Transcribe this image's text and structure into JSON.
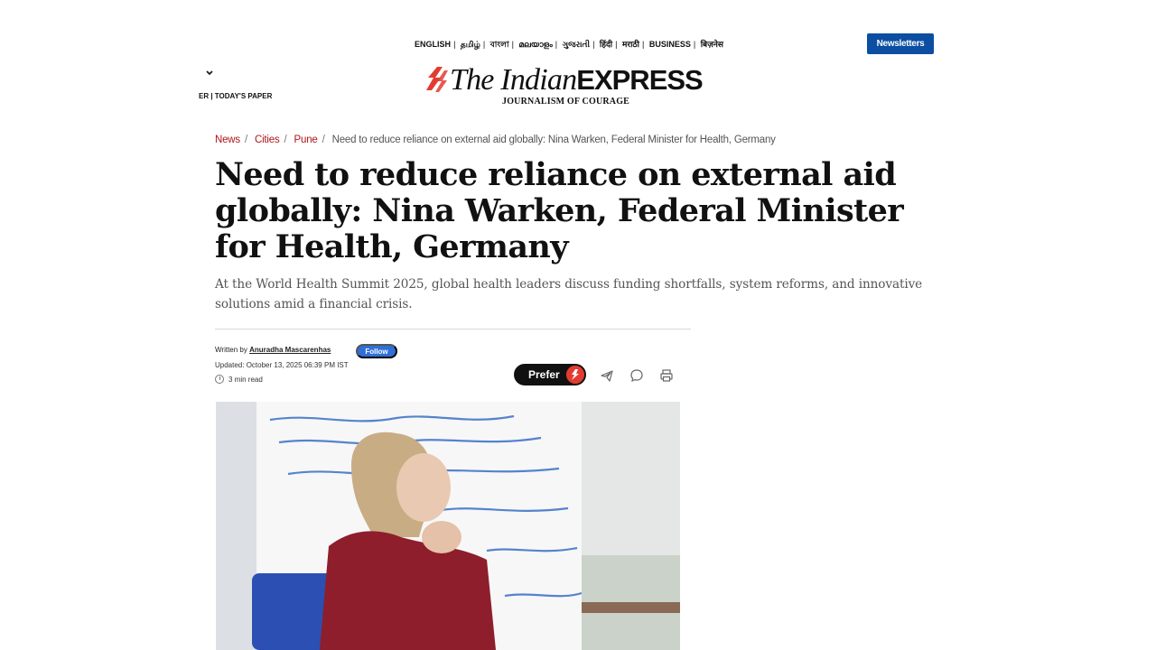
{
  "header": {
    "languages": [
      "ENGLISH",
      "தமிழ்",
      "বাংলা",
      "മലയാളം",
      "ગુજરાતી",
      "हिंदी",
      "मराठी",
      "BUSINESS",
      "बिज़नेस"
    ],
    "newsletter_label": "Newsletters",
    "subnav_text": "ER | TODAY'S PAPER",
    "logo": {
      "italic": "The Indian",
      "bold": "EXPRESS",
      "tagline": "JOURNALISM OF COURAGE"
    }
  },
  "breadcrumb": {
    "items": [
      "News",
      "Cities",
      "Pune"
    ],
    "current": "Need to reduce reliance on external aid globally: Nina Warken, Federal Minister for Health, Germany"
  },
  "article": {
    "headline": "Need to reduce reliance on external aid globally: Nina Warken, Federal Minister for Health, Germany",
    "summary": "At the World Health Summit 2025, global health leaders discuss funding shortfalls, system reforms, and innovative solutions amid a financial crisis.",
    "byline_prefix": "Written by ",
    "author": "Anuradha Mascarenhas",
    "follow_label": "Follow",
    "updated": "Updated: October 13, 2025 06:39 PM IST",
    "read_time": "3 min read",
    "prefer_label": "Prefer"
  },
  "icons": [
    "chevron-down-icon",
    "telegram-icon",
    "comment-icon",
    "print-icon",
    "clock-icon"
  ],
  "colors": {
    "brand_red": "#e23c32",
    "breadcrumb_red": "#b0141b",
    "newsletter_blue": "#0b4ea2",
    "follow_blue": "#2f6fd6"
  }
}
